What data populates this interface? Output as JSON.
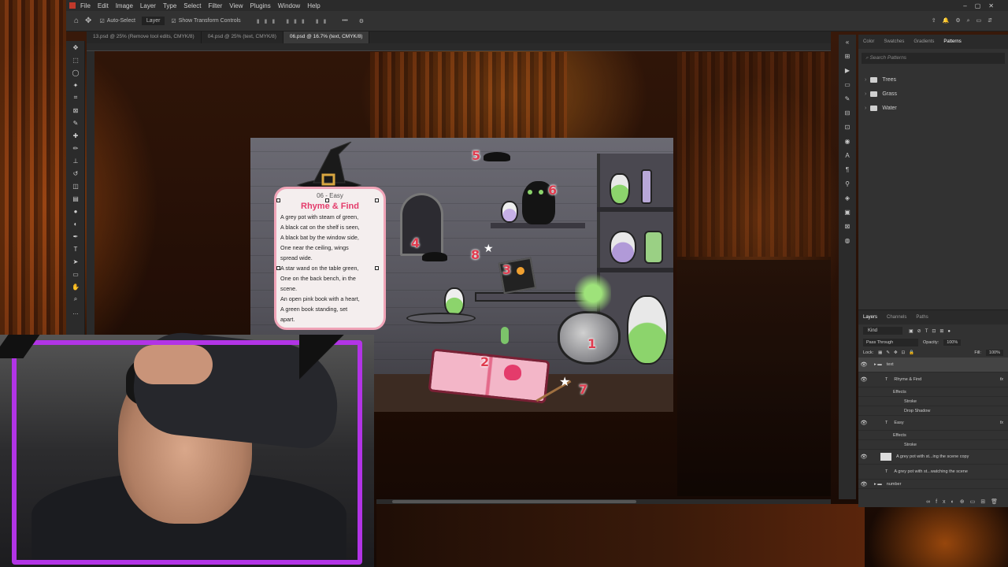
{
  "menubar": {
    "items": [
      "File",
      "Edit",
      "Image",
      "Layer",
      "Type",
      "Select",
      "Filter",
      "View",
      "Plugins",
      "Window",
      "Help"
    ]
  },
  "options": {
    "auto_select_label": "Auto-Select",
    "auto_select_value": "Layer",
    "transform_label": "Show Transform Controls"
  },
  "tabs": [
    {
      "label": "13.psd @ 25% (Remove tool edits, CMYK/8)",
      "active": false
    },
    {
      "label": "04.psd @ 25% (text, CMYK/8)",
      "active": false
    },
    {
      "label": "06.psd @ 16.7% (text, CMYK/8)",
      "active": true
    }
  ],
  "right_panel": {
    "tabs": [
      "Color",
      "Swatches",
      "Gradients",
      "Patterns"
    ],
    "active_tab": "Patterns",
    "search_placeholder": "Search Patterns",
    "folders": [
      "Trees",
      "Grass",
      "Water"
    ]
  },
  "layers_panel": {
    "tabs": [
      "Layers",
      "Channels",
      "Paths"
    ],
    "filter": "Kind",
    "blend_mode": "Pass Through",
    "opacity_label": "Opacity:",
    "opacity_value": "100%",
    "lock_label": "Lock:",
    "fill_label": "Fill:",
    "fill_value": "100%",
    "rows": [
      {
        "name": "text",
        "kind": "group"
      },
      {
        "name": "Rhyme & Find",
        "kind": "text",
        "fx": "fx"
      },
      {
        "name": "Effects",
        "kind": "effects"
      },
      {
        "name": "Stroke",
        "kind": "effect"
      },
      {
        "name": "Drop Shadow",
        "kind": "effect"
      },
      {
        "name": "Easy",
        "kind": "text",
        "fx": "fx"
      },
      {
        "name": "Effects",
        "kind": "effects"
      },
      {
        "name": "Stroke",
        "kind": "effect"
      },
      {
        "name": "A grey pot with st...ing the scene copy",
        "kind": "smart"
      },
      {
        "name": "A grey pot with st...watching the scene",
        "kind": "text"
      },
      {
        "name": "number",
        "kind": "group"
      }
    ]
  },
  "card": {
    "difficulty": "06 - Easy",
    "title": "Rhyme & Find",
    "clues": [
      "A grey pot with steam of green,",
      "A black cat on the shelf is seen,",
      "A black bat by the window side,",
      "One near the ceiling, wings",
      "spread wide.",
      "A star wand on the table green,",
      "One on the back bench, in the",
      "scene.",
      "An open pink book with a heart,",
      "A green book standing, set",
      "apart."
    ]
  },
  "numbers": [
    "1",
    "2",
    "3",
    "4",
    "5",
    "6",
    "7",
    "8"
  ],
  "colors": {
    "accent": "#b234e6",
    "title": "#e43b6b",
    "number": "#e03c4f",
    "card_border": "#f0a4b7"
  }
}
